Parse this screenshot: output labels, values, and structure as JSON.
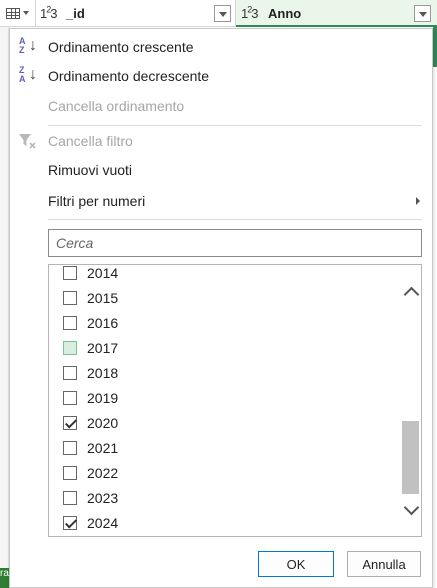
{
  "header": {
    "columns": [
      {
        "type_icon": "123",
        "label": "_id"
      },
      {
        "type_icon": "123",
        "label": "Anno"
      }
    ]
  },
  "menu": {
    "sort_ascending": "Ordinamento crescente",
    "sort_descending": "Ordinamento decrescente",
    "clear_sort": "Cancella ordinamento",
    "clear_filter": "Cancella filtro",
    "remove_empty": "Rimuovi vuoti",
    "number_filters": "Filtri per numeri"
  },
  "search": {
    "placeholder": "Cerca"
  },
  "values": [
    {
      "label": "2014",
      "checked": false
    },
    {
      "label": "2015",
      "checked": false
    },
    {
      "label": "2016",
      "checked": false
    },
    {
      "label": "2017",
      "checked": false,
      "hover": true
    },
    {
      "label": "2018",
      "checked": false
    },
    {
      "label": "2019",
      "checked": false
    },
    {
      "label": "2020",
      "checked": true
    },
    {
      "label": "2021",
      "checked": false
    },
    {
      "label": "2022",
      "checked": false
    },
    {
      "label": "2023",
      "checked": false
    },
    {
      "label": "2024",
      "checked": true
    }
  ],
  "buttons": {
    "ok": "OK",
    "cancel": "Annulla"
  },
  "background": {
    "left_tag": "ra"
  },
  "colors": {
    "accent_green": "#2e8b57",
    "ok_border": "#0078d4",
    "sort_icon": "#5b5fc7"
  }
}
